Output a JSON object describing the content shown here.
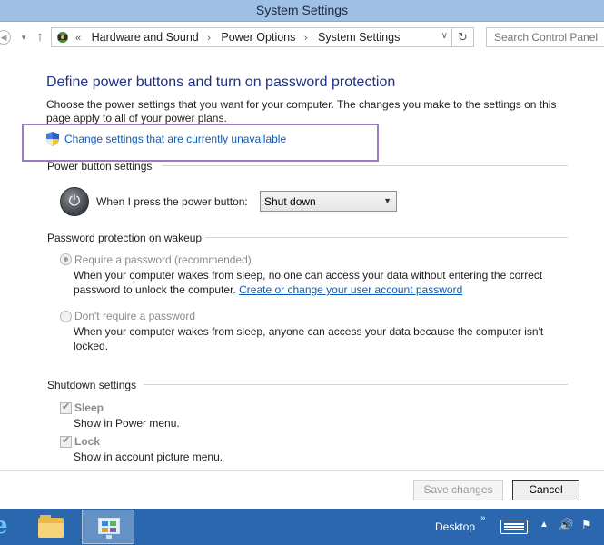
{
  "window": {
    "title": "System Settings"
  },
  "address": {
    "crumbs": [
      "Hardware and Sound",
      "Power Options",
      "System Settings"
    ],
    "search_placeholder": "Search Control Panel"
  },
  "main": {
    "heading": "Define power buttons and turn on password protection",
    "intro": "Choose the power settings that you want for your computer. The changes you make to the settings on this page apply to all of your power plans.",
    "change_link": "Change settings that are currently unavailable",
    "power_section": {
      "title": "Power button settings",
      "label": "When I press the power button:",
      "selected": "Shut down"
    },
    "password_section": {
      "title": "Password protection on wakeup",
      "opt1_label": "Require a password (recommended)",
      "opt1_desc": "When your computer wakes from sleep, no one can access your data without entering the correct password to unlock the computer.",
      "opt1_link": "Create or change your user account password",
      "opt2_label": "Don't require a password",
      "opt2_desc": "When your computer wakes from sleep, anyone can access your data because the computer isn't locked."
    },
    "shutdown_section": {
      "title": "Shutdown settings",
      "sleep_label": "Sleep",
      "sleep_desc": "Show in Power menu.",
      "lock_label": "Lock",
      "lock_desc": "Show in account picture menu."
    }
  },
  "footer": {
    "save": "Save changes",
    "cancel": "Cancel"
  },
  "taskbar": {
    "desktop": "Desktop"
  },
  "icons": {
    "back": "back-arrow-icon",
    "up": "up-arrow-icon",
    "control_panel": "control-panel-icon",
    "refresh": "refresh-icon",
    "shield": "uac-shield-icon",
    "power": "power-icon",
    "ie": "internet-explorer-icon",
    "explorer": "file-explorer-icon",
    "keyboard": "keyboard-icon",
    "speaker": "speaker-icon",
    "flag": "action-center-flag-icon"
  },
  "colors": {
    "titlebar": "#9fbfe4",
    "heading": "#1e3287",
    "link": "#0e5bb8",
    "highlight": "#9a7cc4",
    "taskbar": "#2b67ae"
  }
}
